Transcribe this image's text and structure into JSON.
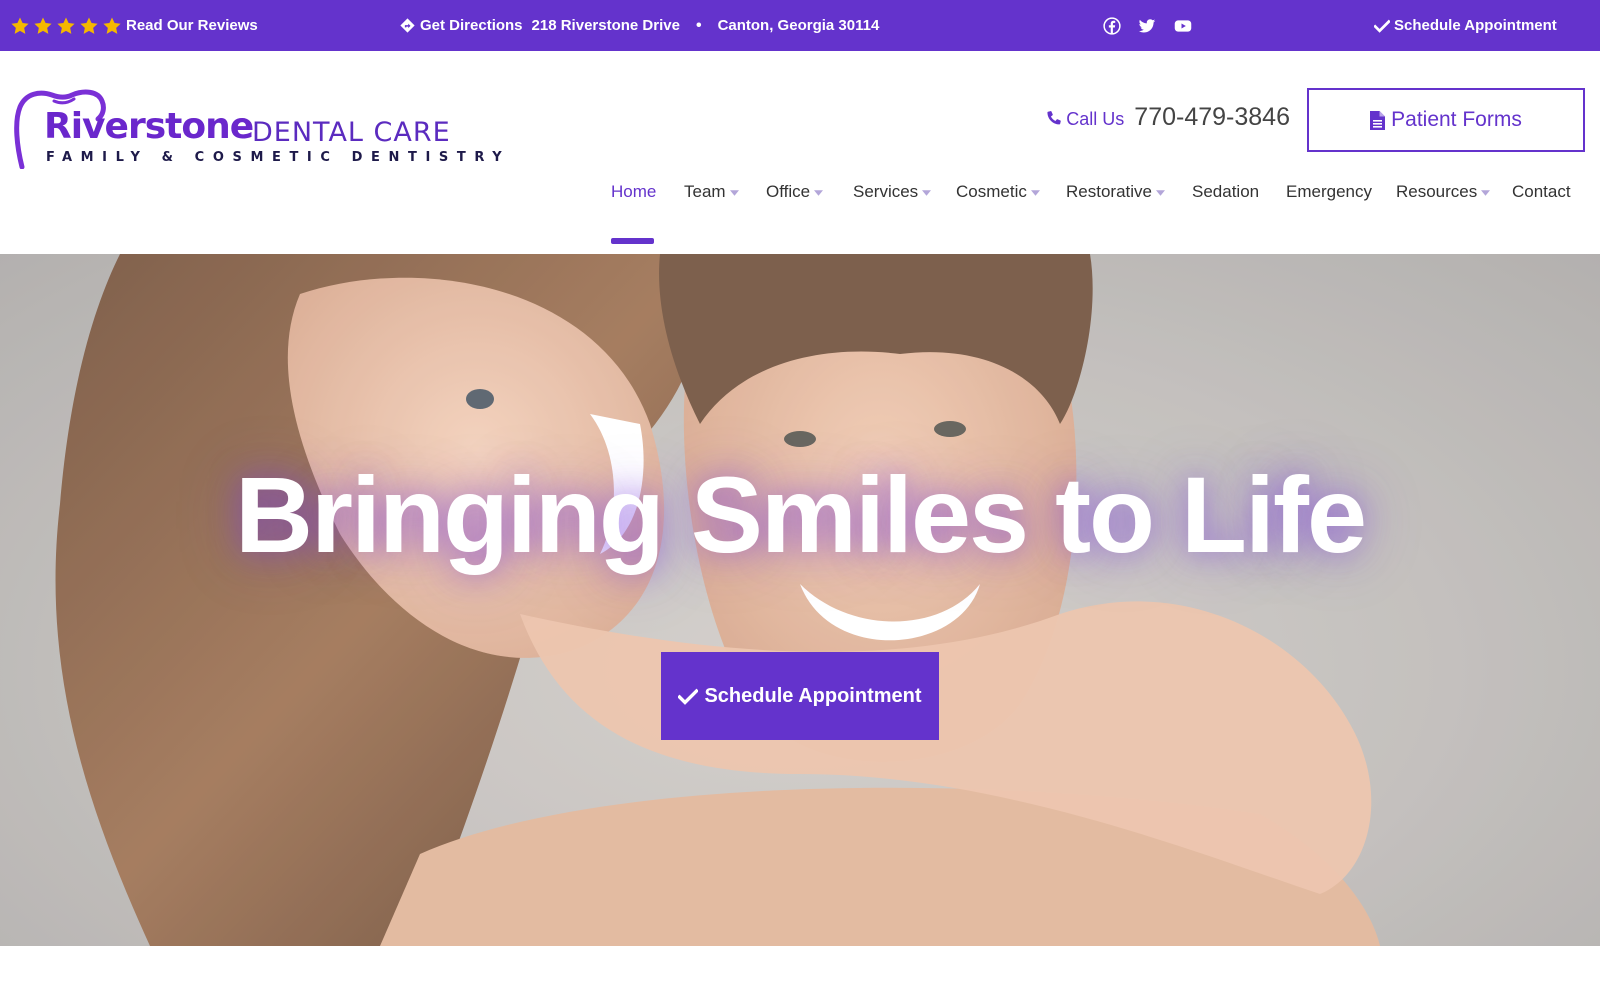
{
  "topbar": {
    "rating_stars": 5,
    "reviews_label": "Read Our Reviews",
    "directions_label": "Get Directions",
    "address_street": "218 Riverstone Drive",
    "address_separator": "•",
    "address_city": "Canton, Georgia 30114",
    "social_icons": [
      "facebook-icon",
      "twitter-icon",
      "youtube-icon"
    ],
    "schedule_label": "Schedule Appointment"
  },
  "logo": {
    "name": "Riverstone",
    "subtitle": "DENTAL CARE",
    "tagline": "FAMILY & COSMETIC DENTISTRY"
  },
  "header": {
    "call_label": "Call Us",
    "phone_number": "770-479-3846",
    "patient_forms_label": "Patient Forms"
  },
  "nav": {
    "items": [
      {
        "label": "Home",
        "active": true,
        "dropdown": false
      },
      {
        "label": "Team",
        "active": false,
        "dropdown": true
      },
      {
        "label": "Office",
        "active": false,
        "dropdown": true
      },
      {
        "label": "Services",
        "active": false,
        "dropdown": true
      },
      {
        "label": "Cosmetic",
        "active": false,
        "dropdown": true
      },
      {
        "label": "Restorative",
        "active": false,
        "dropdown": true
      },
      {
        "label": "Sedation",
        "active": false,
        "dropdown": false
      },
      {
        "label": "Emergency",
        "active": false,
        "dropdown": false
      },
      {
        "label": "Resources",
        "active": false,
        "dropdown": true
      },
      {
        "label": "Contact",
        "active": false,
        "dropdown": false
      }
    ]
  },
  "hero": {
    "headline": "Bringing Smiles to Life",
    "cta_label": "Schedule Appointment"
  },
  "colors": {
    "brand_purple": "#6433cc",
    "star_gold": "#f5b800",
    "text_dark": "#333333"
  }
}
